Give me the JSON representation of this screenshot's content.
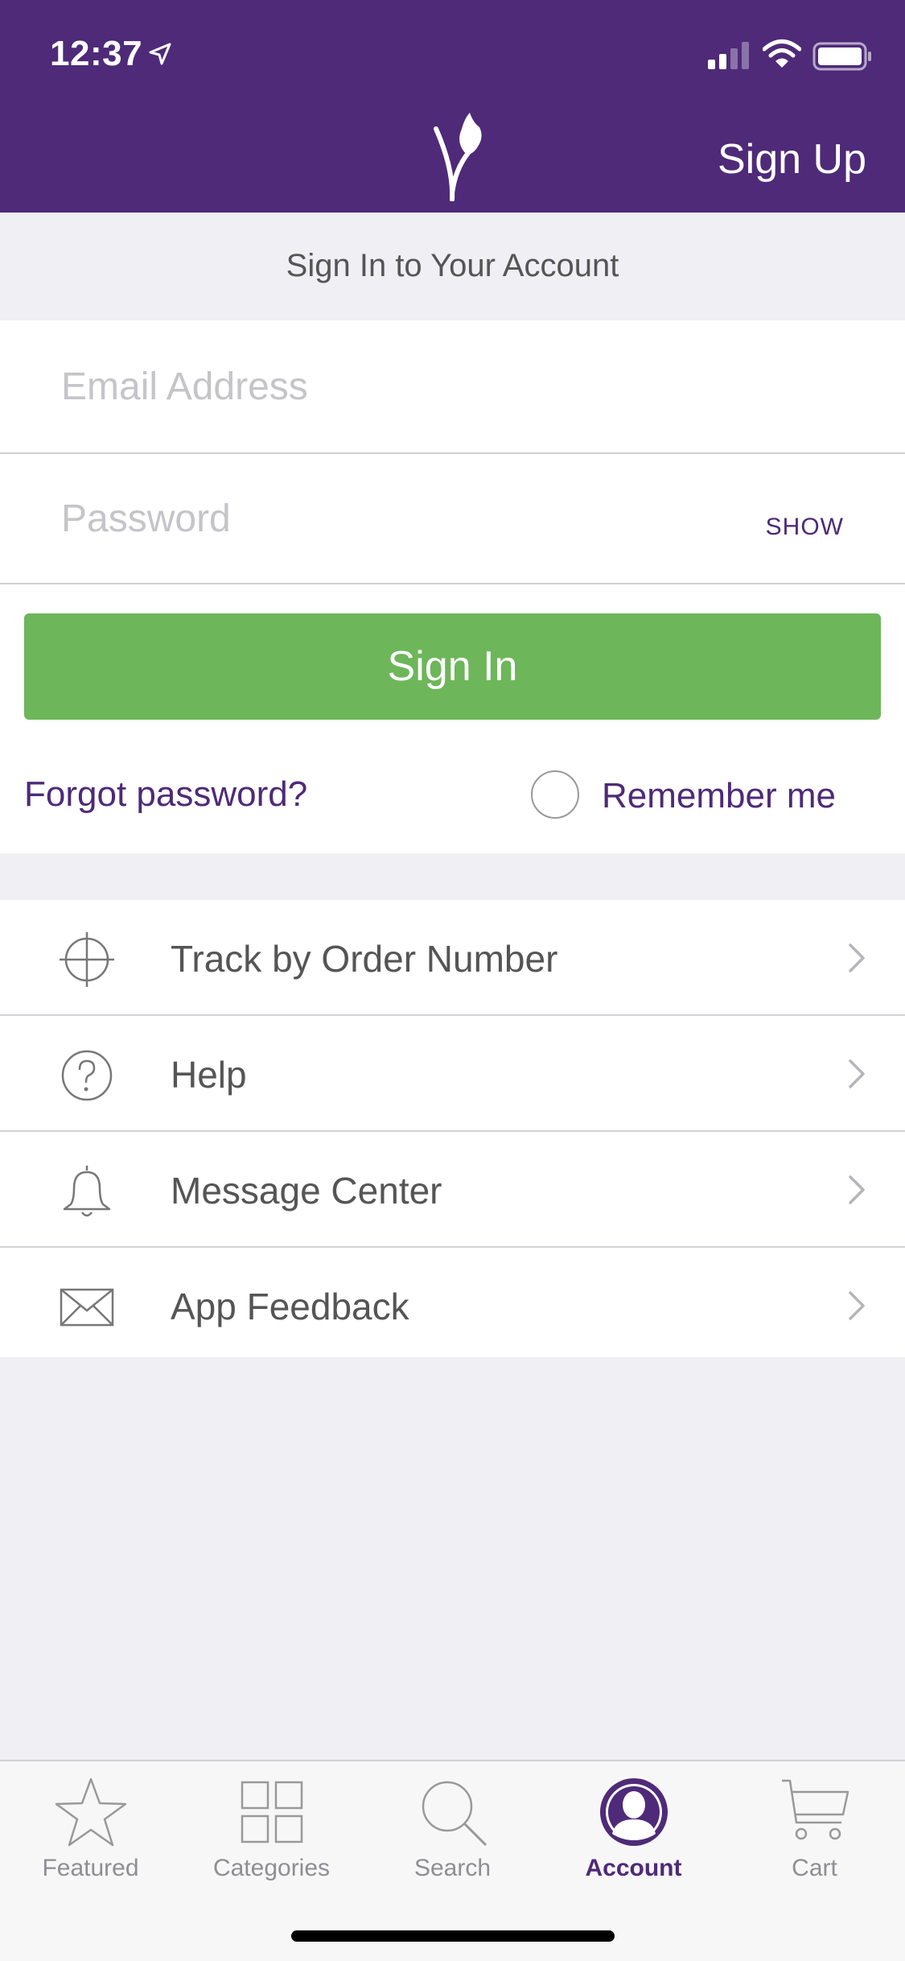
{
  "status_bar": {
    "time": "12:37"
  },
  "header": {
    "signup_label": "Sign Up"
  },
  "subtitle": "Sign In to Your Account",
  "form": {
    "email_placeholder": "Email Address",
    "password_placeholder": "Password",
    "show_label": "SHOW",
    "signin_label": "Sign In",
    "forgot_label": "Forgot password?",
    "remember_label": "Remember me"
  },
  "menu": {
    "items": [
      {
        "label": "Track by Order Number",
        "icon": "crosshair-icon"
      },
      {
        "label": "Help",
        "icon": "question-icon"
      },
      {
        "label": "Message Center",
        "icon": "bell-icon"
      },
      {
        "label": "App Feedback",
        "icon": "envelope-icon"
      }
    ]
  },
  "tabbar": {
    "tabs": [
      {
        "label": "Featured",
        "icon": "star-icon"
      },
      {
        "label": "Categories",
        "icon": "grid-icon"
      },
      {
        "label": "Search",
        "icon": "search-icon"
      },
      {
        "label": "Account",
        "icon": "account-icon",
        "active": true
      },
      {
        "label": "Cart",
        "icon": "cart-icon"
      }
    ]
  },
  "colors": {
    "brand_purple": "#4e2a78",
    "signin_green": "#6db65a",
    "background": "#efeff4"
  }
}
